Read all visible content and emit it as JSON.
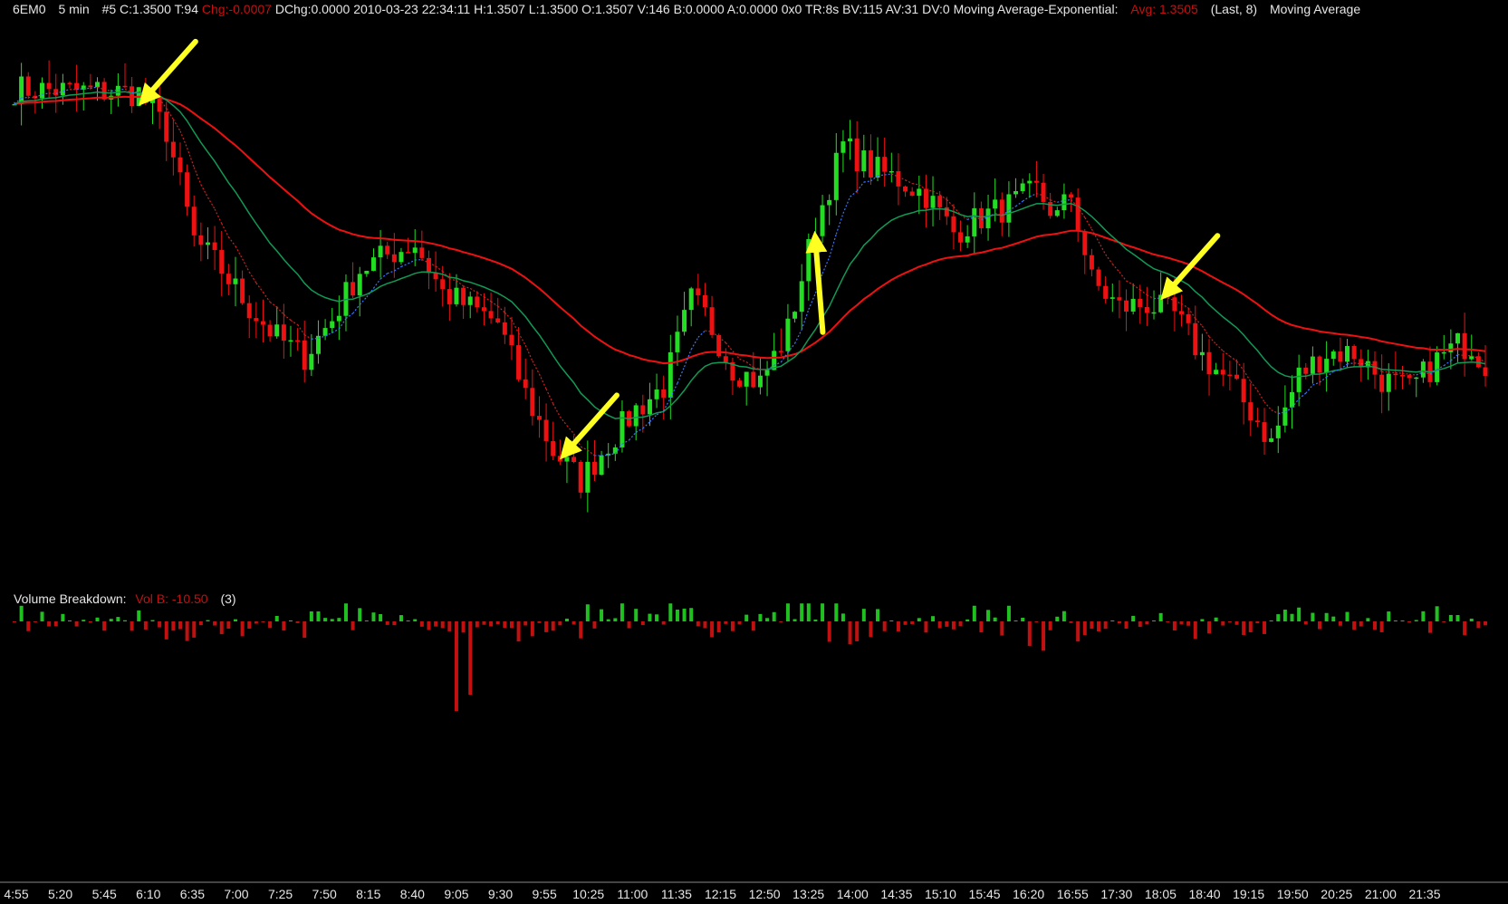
{
  "header": {
    "symbol": "6EM0",
    "timeframe": "5 min",
    "bar_info": "#5 C:1.3500 T:94",
    "chg": "Chg:-0.0007",
    "details": "DChg:0.0000 2010-03-23 22:34:11 H:1.3507 L:1.3500 O:1.3507 V:146 B:0.0000 A:0.0000 0x0 TR:8s BV:115 AV:31 DV:0",
    "ma_title": "Moving Average-Exponential:",
    "ma_value": "Avg: 1.3505",
    "ma_params": "(Last, 8)",
    "ma_title2": "Moving Average"
  },
  "volume_panel": {
    "title": "Volume Breakdown:",
    "value": "Vol B: -10.50",
    "params": "(3)"
  },
  "colors": {
    "up": "#22dd22",
    "down": "#ee1111",
    "ema_slow": "#ee1111",
    "ema_mid": "#119955",
    "ema_fast_up": "#3377ff",
    "ema_fast_down": "#cc2222",
    "arrow": "#ffff22",
    "vol_up": "#20c020",
    "vol_down": "#c01010"
  },
  "chart_data": {
    "type": "candlestick",
    "x_tick_labels": [
      "4:55",
      "5:20",
      "5:45",
      "6:10",
      "6:35",
      "7:00",
      "7:25",
      "7:50",
      "8:15",
      "8:40",
      "9:05",
      "9:30",
      "9:55",
      "10:25",
      "11:00",
      "11:35",
      "12:15",
      "12:50",
      "13:25",
      "14:00",
      "14:35",
      "15:10",
      "15:45",
      "16:20",
      "16:55",
      "17:30",
      "18:05",
      "18:40",
      "19:15",
      "19:50",
      "20:25",
      "21:00",
      "21:35"
    ],
    "price_anchors": [
      [
        0,
        1.3566
      ],
      [
        18,
        1.3565
      ],
      [
        22,
        1.3555
      ],
      [
        26,
        1.3526
      ],
      [
        30,
        1.3518
      ],
      [
        34,
        1.3508
      ],
      [
        38,
        1.35
      ],
      [
        42,
        1.3495
      ],
      [
        46,
        1.3505
      ],
      [
        50,
        1.3518
      ],
      [
        54,
        1.3522
      ],
      [
        58,
        1.3525
      ],
      [
        62,
        1.3512
      ],
      [
        66,
        1.3508
      ],
      [
        70,
        1.3504
      ],
      [
        74,
        1.3485
      ],
      [
        78,
        1.347
      ],
      [
        82,
        1.3462
      ],
      [
        86,
        1.3472
      ],
      [
        90,
        1.3481
      ],
      [
        94,
        1.3487
      ],
      [
        98,
        1.351
      ],
      [
        100,
        1.3506
      ],
      [
        104,
        1.3492
      ],
      [
        108,
        1.3488
      ],
      [
        112,
        1.3502
      ],
      [
        116,
        1.353
      ],
      [
        120,
        1.3551
      ],
      [
        124,
        1.3545
      ],
      [
        128,
        1.3542
      ],
      [
        132,
        1.3538
      ],
      [
        136,
        1.3528
      ],
      [
        140,
        1.3532
      ],
      [
        144,
        1.3535
      ],
      [
        148,
        1.3539
      ],
      [
        151,
        1.3532
      ],
      [
        153,
        1.3538
      ],
      [
        156,
        1.3515
      ],
      [
        160,
        1.3508
      ],
      [
        164,
        1.3509
      ],
      [
        168,
        1.3506
      ],
      [
        172,
        1.3495
      ],
      [
        176,
        1.3488
      ],
      [
        180,
        1.3478
      ],
      [
        182,
        1.3472
      ],
      [
        186,
        1.349
      ],
      [
        190,
        1.3496
      ],
      [
        194,
        1.3496
      ],
      [
        198,
        1.3489
      ],
      [
        202,
        1.3486
      ],
      [
        206,
        1.3494
      ],
      [
        209,
        1.3498
      ],
      [
        211,
        1.3498
      ],
      [
        213,
        1.3493
      ]
    ],
    "price_range": [
      1.3455,
      1.358
    ],
    "ema_periods": [
      8,
      20,
      50
    ],
    "volume_spikes": [
      [
        64,
        -11.0
      ],
      [
        66,
        -9.0
      ],
      [
        118,
        -2.5
      ],
      [
        121,
        -2.8
      ],
      [
        147,
        -3.0
      ],
      [
        149,
        -3.6
      ]
    ],
    "annotations": [
      {
        "type": "arrow",
        "direction": "down-left",
        "at_bar": 19
      },
      {
        "type": "arrow",
        "direction": "down-left",
        "at_bar": 80
      },
      {
        "type": "arrow",
        "direction": "up",
        "at_bar": 116
      },
      {
        "type": "arrow",
        "direction": "down-left",
        "at_bar": 167
      }
    ]
  }
}
